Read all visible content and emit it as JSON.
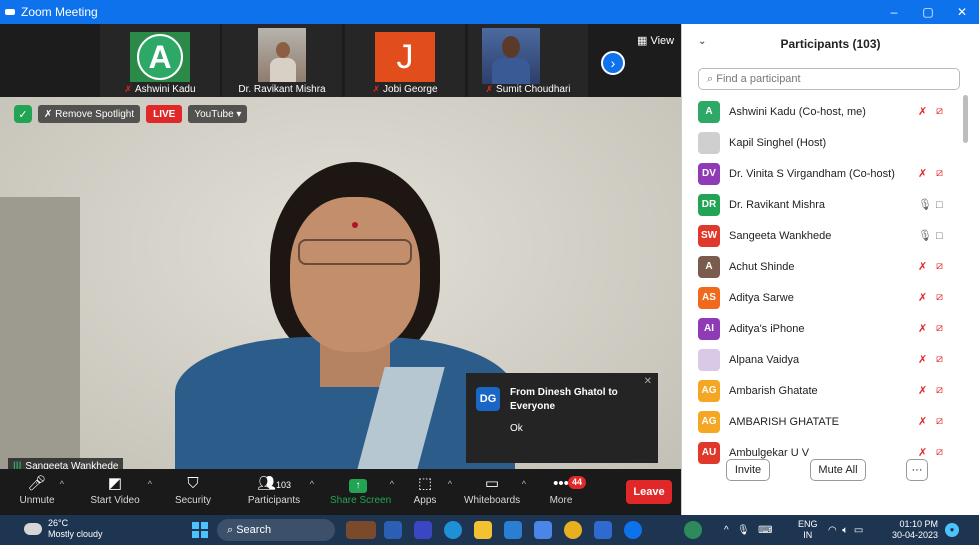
{
  "window": {
    "title": "Zoom Meeting",
    "controls": [
      "–",
      "▢",
      "✕"
    ]
  },
  "thumbnails": [
    {
      "name": "Ashwini Kadu",
      "avatar_letter": "A",
      "muted": true
    },
    {
      "name": "Dr. Ravikant Mishra",
      "muted": false
    },
    {
      "name": "Jobi George",
      "avatar_letter": "J",
      "muted": true
    },
    {
      "name": "Sumit Choudhari",
      "muted": true
    }
  ],
  "view_label": "View",
  "badges": {
    "remove_spotlight": "Remove Spotlight",
    "live": "LIVE",
    "youtube": "YouTube"
  },
  "speaker_name": "Sangeeta Wankhede",
  "chat_popup": {
    "initials": "DG",
    "from": "From Dinesh Ghatol to Everyone",
    "message": "Ok"
  },
  "toolbar": {
    "unmute": "Unmute",
    "start_video": "Start Video",
    "security": "Security",
    "participants": "Participants",
    "participants_count": "103",
    "share_screen": "Share Screen",
    "apps": "Apps",
    "whiteboards": "Whiteboards",
    "more": "More",
    "more_badge": "44",
    "leave": "Leave"
  },
  "panel": {
    "title": "Participants (103)",
    "search_placeholder": "Find a participant",
    "participants": [
      {
        "initials": "A",
        "name": "Ashwini Kadu (Co-host, me)",
        "color": "#2ea866",
        "mic": "muted",
        "video": "off"
      },
      {
        "initials": "",
        "name": "Kapil Singhel (Host)",
        "color": "#cfcfcf",
        "mic": "none",
        "video": "none"
      },
      {
        "initials": "DV",
        "name": "Dr. Vinita  S Virgandham (Co-host)",
        "color": "#8e3bb5",
        "mic": "muted",
        "video": "off"
      },
      {
        "initials": "DR",
        "name": "Dr. Ravikant Mishra",
        "color": "#23a455",
        "mic": "on",
        "video": "on"
      },
      {
        "initials": "SW",
        "name": "Sangeeta Wankhede",
        "color": "#e0382a",
        "mic": "on",
        "video": "on"
      },
      {
        "initials": "A",
        "name": "Achut Shinde",
        "color": "#7a5c4e",
        "mic": "muted",
        "video": "off"
      },
      {
        "initials": "AS",
        "name": "Aditya Sarwe",
        "color": "#f06a1e",
        "mic": "muted",
        "video": "off"
      },
      {
        "initials": "AI",
        "name": "Aditya's iPhone",
        "color": "#8e3bb5",
        "mic": "muted",
        "video": "off"
      },
      {
        "initials": "",
        "name": "Alpana Vaidya",
        "color": "#d9c8e6",
        "mic": "muted",
        "video": "off"
      },
      {
        "initials": "AG",
        "name": "Ambarish Ghatate",
        "color": "#f5a623",
        "mic": "muted",
        "video": "off"
      },
      {
        "initials": "AG",
        "name": "AMBARISH GHATATE",
        "color": "#f5a623",
        "mic": "muted",
        "video": "off"
      },
      {
        "initials": "AU",
        "name": "Ambulgekar U V",
        "color": "#e0382a",
        "mic": "muted",
        "video": "off"
      }
    ],
    "invite": "Invite",
    "mute_all": "Mute All",
    "more": "···"
  },
  "taskbar": {
    "temp": "26°C",
    "weather": "Mostly cloudy",
    "search": "Search",
    "lang": "ENG",
    "region": "IN",
    "time": "01:10 PM",
    "date": "30-04-2023"
  }
}
